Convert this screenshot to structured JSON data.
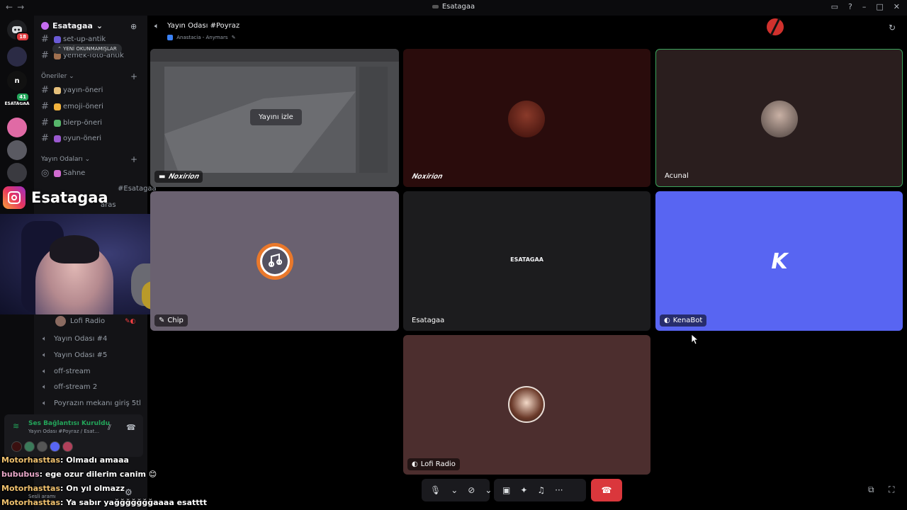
{
  "window": {
    "title": "Esatagaa"
  },
  "rail": {
    "dm_badge": "18",
    "server_n": "n",
    "server_esatagaa": "ESATAGAA",
    "esatagaa_badge": "41"
  },
  "sidebar": {
    "server_name": "Esatagaa",
    "channels_top": [
      {
        "label": "set-up-antik"
      },
      {
        "label": "yemek-foto-antik"
      }
    ],
    "unread_pill": "YENİ OKUNMAMIŞLAR",
    "category_suggestions": "Öneriler",
    "suggestion_channels": [
      {
        "label": "yayın-öneri"
      },
      {
        "label": "emoji-öneri"
      },
      {
        "label": "blerp-öneri"
      },
      {
        "label": "oyun-öneri"
      }
    ],
    "category_stream_rooms": "Yayın Odaları",
    "stage_channel": "Sahne",
    "partial_channel_1": "#Esatagaa",
    "partial_channel_2": "aras",
    "lofi_member": "Lofi Radio",
    "voice_channels": [
      {
        "label": "Yayın Odası #4"
      },
      {
        "label": "Yayın Odası #5"
      },
      {
        "label": "off-stream"
      },
      {
        "label": "off-stream 2"
      },
      {
        "label": "Poyrazın mekanı giriş 5tl"
      }
    ]
  },
  "voice_panel": {
    "status": "Ses Bağlantısı Kuruldu",
    "subtitle": "Yayın Odası #Poyraz / Esat...",
    "bottom_label": "Sesli aramı"
  },
  "overlay": {
    "instagram_name": "Esatagaa",
    "chat": [
      {
        "user": "Motorhasttas",
        "message": ": Olmadı amaaa"
      },
      {
        "user": "bububus",
        "message": ": ege ozur dilerim canim 😊"
      },
      {
        "user": "Motorhasttas",
        "message": ": On yıl olmazz"
      },
      {
        "user": "Motorhasttas",
        "message": ": Ya sabır yağğğğğğğaaaa esatttt"
      }
    ]
  },
  "header": {
    "channel_title": "Yayın Odası #Poyraz",
    "channel_subtitle": "Anastacia - Anymars"
  },
  "tiles": {
    "stream": {
      "label": "𝑵𝒐𝒙𝒊𝒓𝒊𝒐𝒏",
      "watch_label": "Yayını izle"
    },
    "noxirion": {
      "label": "𝑵𝒐𝒙𝒊𝒓𝒊𝒐𝒏"
    },
    "acunal": {
      "label": "Acunal"
    },
    "chip": {
      "label": "Chip"
    },
    "esatagaa": {
      "label": "Esatagaa",
      "center_text": "ESATAGAA"
    },
    "kenabot": {
      "label": "KenaBot",
      "logo": "K"
    },
    "lofi": {
      "label": "Lofi Radio"
    }
  },
  "colors": {
    "speaking_outline": "#3ba55c",
    "kenabot_bg": "#5865f2",
    "hangup": "#da373c",
    "voice_status": "#23a55a"
  },
  "icons": [
    "back-arrow-icon",
    "forward-arrow-icon",
    "inbox-icon",
    "help-icon",
    "minimize-icon",
    "maximize-icon",
    "close-icon",
    "speaker-icon",
    "microphone-icon",
    "camera-off-icon",
    "screen-share-icon",
    "activities-icon",
    "soundboard-icon",
    "more-icon",
    "hangup-icon",
    "popout-icon",
    "fullscreen-icon"
  ]
}
